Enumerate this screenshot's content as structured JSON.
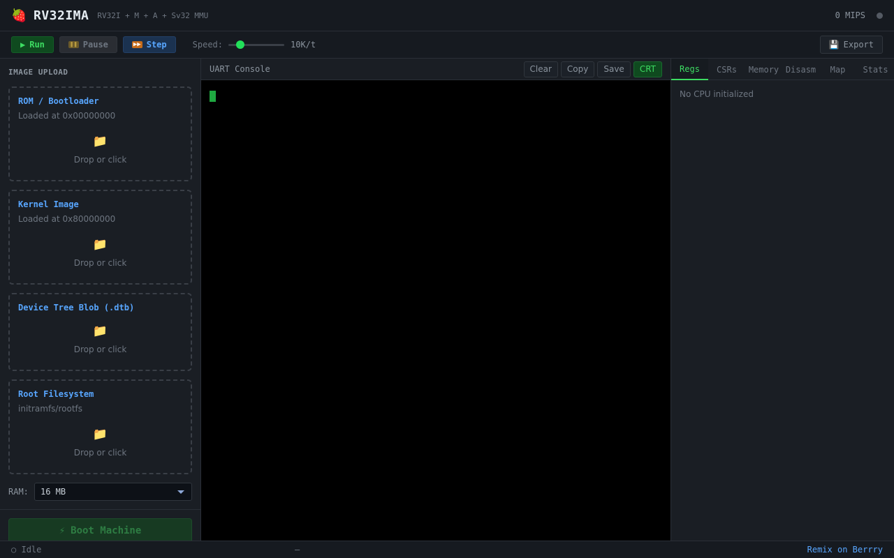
{
  "header": {
    "logo_icon": "🍓",
    "title": "RV32IMA",
    "subtitle": "RV32I + M + A + Sv32 MMU",
    "mips": "0 MIPS",
    "status_dot_color": "#545a63"
  },
  "toolbar": {
    "run_icon": "▶",
    "run_label": "Run",
    "pause_icon": "⏸",
    "pause_label": "Pause",
    "step_icon": "⏩",
    "step_label": "Step",
    "speed_label": "Speed:",
    "speed_value": "10K/t",
    "speed_fraction": 0.16,
    "export_icon": "💾",
    "export_label": "Export"
  },
  "left_panel": {
    "heading": "IMAGE UPLOAD",
    "cards": [
      {
        "title": "ROM / Bootloader",
        "subtitle": "Loaded at 0x00000000",
        "icon": "📁",
        "drop_text": "Drop or click"
      },
      {
        "title": "Kernel Image",
        "subtitle": "Loaded at 0x80000000",
        "icon": "📁",
        "drop_text": "Drop or click"
      },
      {
        "title": "Device Tree Blob (.dtb)",
        "subtitle": "",
        "icon": "📁",
        "drop_text": "Drop or click"
      },
      {
        "title": "Root Filesystem",
        "subtitle": "initramfs/rootfs",
        "icon": "📁",
        "drop_text": "Drop or click"
      }
    ],
    "ram_label": "RAM:",
    "ram_value": "16 MB",
    "boot_icon": "⚡",
    "boot_label": "Boot Machine"
  },
  "console": {
    "title": "UART Console",
    "buttons": {
      "clear": "Clear",
      "copy": "Copy",
      "save": "Save",
      "crt": "CRT"
    },
    "output": ""
  },
  "right_panel": {
    "tabs": [
      {
        "label": "Regs",
        "active": true
      },
      {
        "label": "CSRs",
        "active": false
      },
      {
        "label": "Memory",
        "active": false
      },
      {
        "label": "Disasm",
        "active": false
      },
      {
        "label": "Map",
        "active": false
      },
      {
        "label": "Stats",
        "active": false
      }
    ],
    "empty_message": "No CPU initialized"
  },
  "statusbar": {
    "state_icon": "○",
    "state": "Idle",
    "center": "—",
    "remix_link": "Remix on Berrry"
  },
  "colors": {
    "accent_green": "#3ddc62",
    "accent_blue": "#58a6ff",
    "background": "#161a20"
  }
}
